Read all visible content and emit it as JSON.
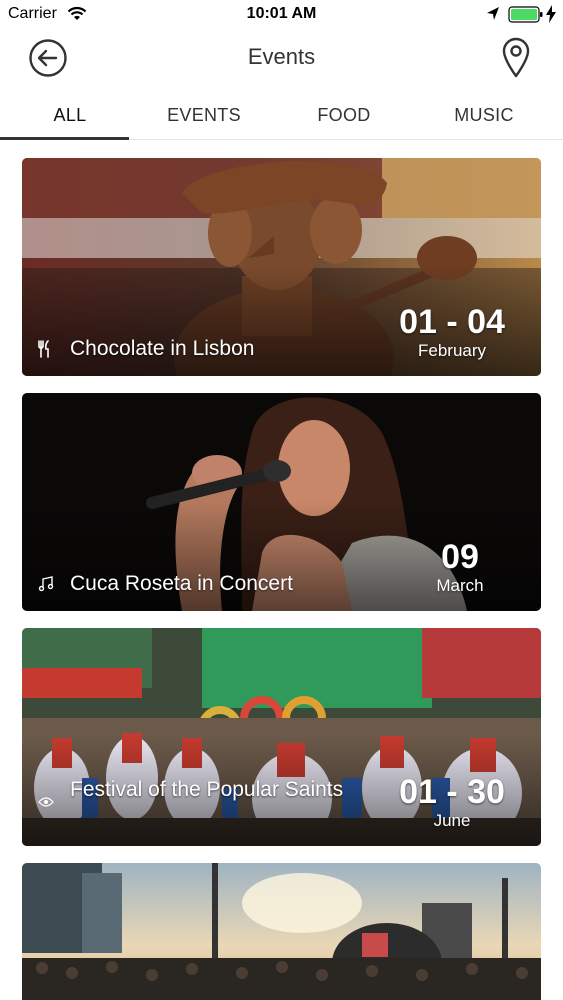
{
  "status_bar": {
    "carrier": "Carrier",
    "time": "10:01 AM"
  },
  "nav": {
    "title": "Events",
    "back_icon": "arrow-left-circle-icon",
    "map_icon": "map-pin-icon"
  },
  "tabs": [
    {
      "label": "ALL",
      "active": true
    },
    {
      "label": "EVENTS",
      "active": false
    },
    {
      "label": "FOOD",
      "active": false
    },
    {
      "label": "MUSIC",
      "active": false
    }
  ],
  "events": [
    {
      "title": "Chocolate in Lisbon",
      "category_icon": "fork-knife-icon",
      "days": "01 - 04",
      "month": "February"
    },
    {
      "title": "Cuca Roseta in Concert",
      "category_icon": "music-note-icon",
      "days": "09",
      "month": "March"
    },
    {
      "title": "Festival of the Popular Saints",
      "category_icon": "eye-icon",
      "days": "01 - 30",
      "month": "June"
    },
    {
      "title": "",
      "category_icon": "",
      "days": "",
      "month": ""
    }
  ],
  "colors": {
    "accent": "#333333",
    "tab_indicator": "#333333",
    "battery": "#4cd964"
  }
}
